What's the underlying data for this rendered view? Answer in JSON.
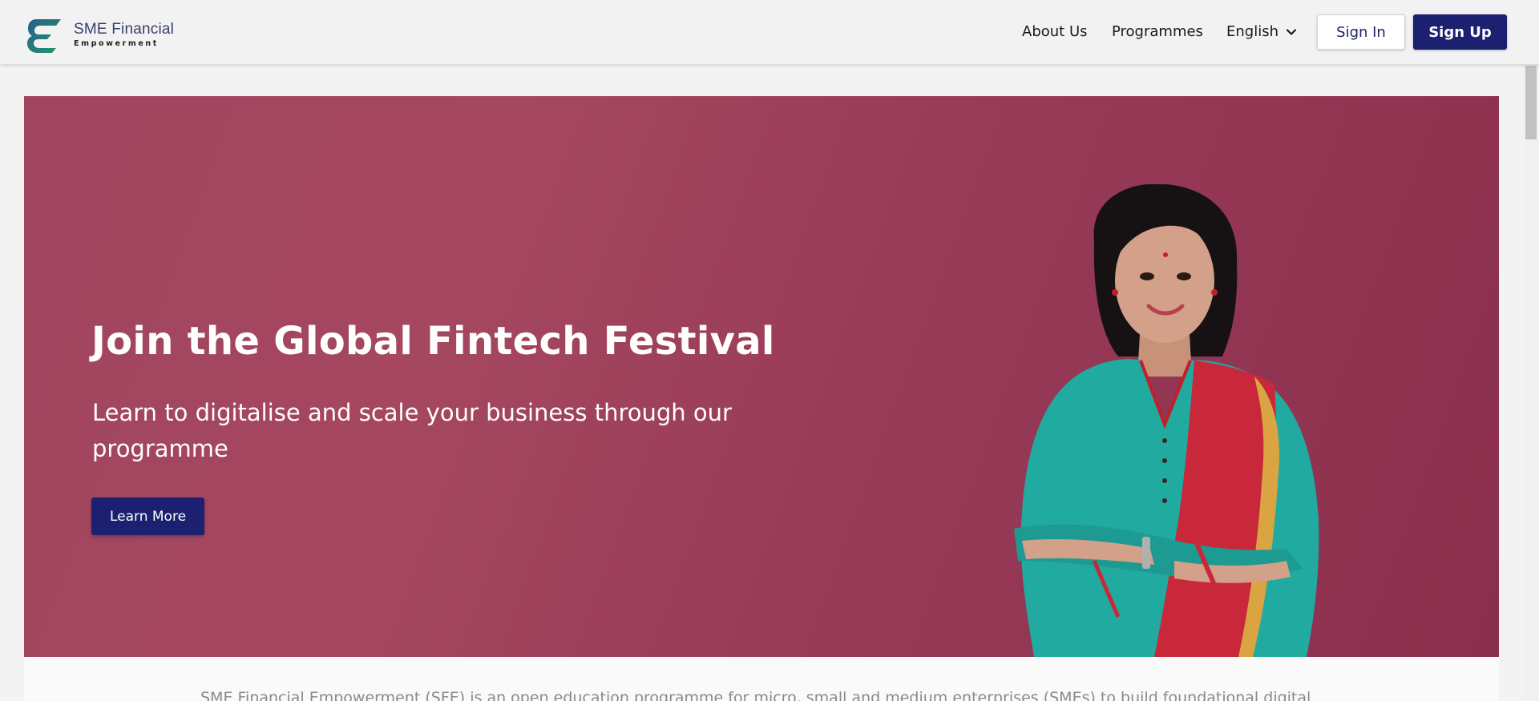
{
  "header": {
    "logo_title": "SME Financial",
    "logo_subtitle": "Empowerment",
    "nav": {
      "about": "About Us",
      "programmes": "Programmes",
      "language": "English"
    },
    "sign_in": "Sign In",
    "sign_up": "Sign Up"
  },
  "hero": {
    "title": "Join the Global Fintech Festival",
    "subtitle": "Learn to digitalise and scale your business through our programme",
    "cta": "Learn More"
  },
  "intro": {
    "text": "SME Financial Empowerment (SFE) is an open education programme for micro, small and medium enterprises (SMEs) to build foundational digital"
  },
  "colors": {
    "brand_navy": "#1b2070",
    "hero_bg": "#a14560",
    "logo_green": "#1f9a6a"
  },
  "icons": {
    "language_dropdown": "chevron-down-icon",
    "logo": "sfe-logo-icon"
  }
}
